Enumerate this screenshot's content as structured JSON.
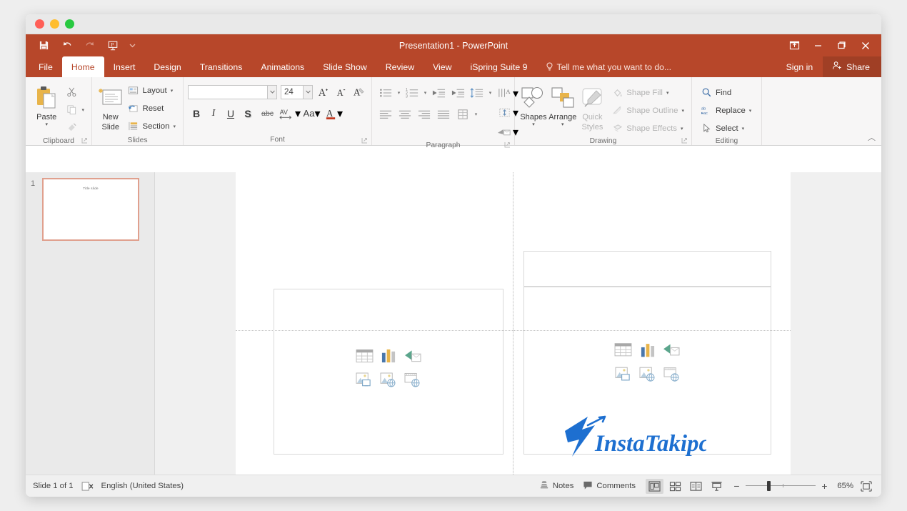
{
  "window": {
    "title": "Presentation1 - PowerPoint",
    "mac_controls": [
      "close",
      "minimize",
      "maximize"
    ]
  },
  "quick_access": {
    "buttons": [
      {
        "name": "save",
        "icon": "save-icon"
      },
      {
        "name": "undo",
        "icon": "undo-icon"
      },
      {
        "name": "redo",
        "icon": "redo-icon"
      },
      {
        "name": "start-from-beginning",
        "icon": "slideshow-icon"
      }
    ],
    "customize_tooltip": "Customize Quick Access Toolbar"
  },
  "window_controls": {
    "ribbon_display": "Ribbon Display Options",
    "minimize": "Minimize",
    "restore": "Restore Down",
    "close": "Close"
  },
  "tabs": [
    {
      "label": "File",
      "active": false
    },
    {
      "label": "Home",
      "active": true
    },
    {
      "label": "Insert",
      "active": false
    },
    {
      "label": "Design",
      "active": false
    },
    {
      "label": "Transitions",
      "active": false
    },
    {
      "label": "Animations",
      "active": false
    },
    {
      "label": "Slide Show",
      "active": false
    },
    {
      "label": "Review",
      "active": false
    },
    {
      "label": "View",
      "active": false
    },
    {
      "label": "iSpring Suite 9",
      "active": false
    }
  ],
  "tell_me": {
    "placeholder": "Tell me what you want to do..."
  },
  "account": {
    "sign_in": "Sign in",
    "share": "Share"
  },
  "ribbon": {
    "groups": {
      "clipboard": {
        "label": "Clipboard",
        "paste": "Paste",
        "cut": "Cut",
        "copy": "Copy",
        "format_painter": "Format Painter"
      },
      "slides": {
        "label": "Slides",
        "new_slide_line1": "New",
        "new_slide_line2": "Slide",
        "layout": "Layout",
        "reset": "Reset",
        "section": "Section"
      },
      "font": {
        "label": "Font",
        "font_name_value": "",
        "font_name_placeholder": "",
        "font_size_value": "24",
        "bold": "B",
        "italic": "I",
        "underline": "U",
        "shadow": "S",
        "strikethrough": "abc",
        "char_spacing": "AV",
        "change_case": "Aa",
        "font_color": "A",
        "increase_size": "A",
        "decrease_size": "A",
        "clear_formatting": "Clear All Formatting"
      },
      "paragraph": {
        "label": "Paragraph",
        "bullets": "Bullets",
        "numbering": "Numbering",
        "decrease_indent": "Decrease List Level",
        "increase_indent": "Increase List Level",
        "line_spacing": "Line Spacing",
        "text_direction": "Text Direction",
        "align_text": "Align Text",
        "convert_smartart": "Convert to SmartArt",
        "align_left": "Align Left",
        "center": "Center",
        "align_right": "Align Right",
        "justify": "Justify",
        "columns": "Columns"
      },
      "drawing": {
        "label": "Drawing",
        "shapes": "Shapes",
        "arrange": "Arrange",
        "quick_styles_line1": "Quick",
        "quick_styles_line2": "Styles",
        "shape_fill": "Shape Fill",
        "shape_outline": "Shape Outline",
        "shape_effects": "Shape Effects"
      },
      "editing": {
        "label": "Editing",
        "find": "Find",
        "replace": "Replace",
        "select": "Select"
      }
    },
    "collapse_tooltip": "Collapse the Ribbon"
  },
  "thumbnails": {
    "slides": [
      {
        "number": "1",
        "title": "Title slide",
        "selected": true
      }
    ]
  },
  "slide_editor": {
    "placeholder_icons": [
      {
        "name": "insert-table-icon",
        "label": "Insert Table"
      },
      {
        "name": "insert-chart-icon",
        "label": "Insert Chart"
      },
      {
        "name": "insert-smartart-icon",
        "label": "Insert a SmartArt Graphic"
      },
      {
        "name": "pictures-icon",
        "label": "Pictures"
      },
      {
        "name": "online-pictures-icon",
        "label": "Online Pictures"
      },
      {
        "name": "insert-video-icon",
        "label": "Insert Video"
      }
    ],
    "watermark_text": "InstaTakipci"
  },
  "status_bar": {
    "slide_counter": "Slide 1 of 1",
    "language": "English (United States)",
    "accessibility_icon": "accessibility-check-icon",
    "notes": "Notes",
    "comments": "Comments",
    "views": [
      {
        "name": "normal-view",
        "label": "Normal",
        "active": true
      },
      {
        "name": "slide-sorter-view",
        "label": "Slide Sorter",
        "active": false
      },
      {
        "name": "reading-view",
        "label": "Reading View",
        "active": false
      },
      {
        "name": "slide-show-view",
        "label": "Slide Show",
        "active": false
      }
    ],
    "zoom_out": "−",
    "zoom_in": "+",
    "zoom_level": "65%",
    "fit_to_window": "Fit slide to current window"
  },
  "colors": {
    "accent": "#b7472a",
    "share_bg": "#a03f25",
    "ribbon_bg": "#f7f6f6",
    "workspace_bg": "#f0f0f0",
    "thumb_border": "#e0a08e",
    "watermark": "#1d6fd0"
  }
}
